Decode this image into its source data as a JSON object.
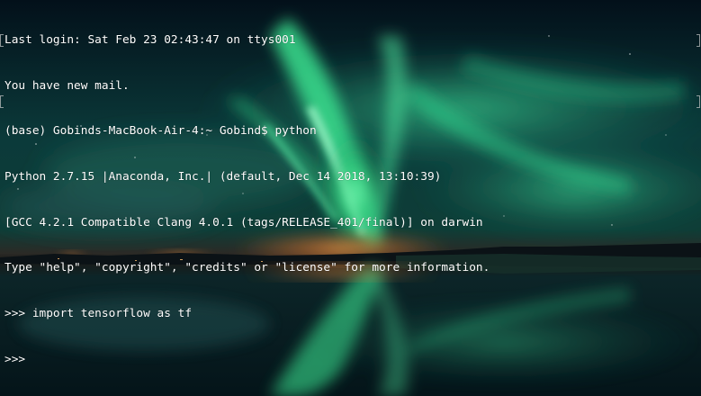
{
  "terminal": {
    "lines": [
      "Last login: Sat Feb 23 02:43:47 on ttys001",
      "You have new mail.",
      "(base) Gobinds-MacBook-Air-4:~ Gobind$ python",
      "Python 2.7.15 |Anaconda, Inc.| (default, Dec 14 2018, 13:10:39)",
      "[GCC 4.2.1 Compatible Clang 4.0.1 (tags/RELEASE_401/final)] on darwin",
      "Type \"help\", \"copyright\", \"credits\" or \"license\" for more information.",
      ">>> import tensorflow as tf",
      ">>> "
    ]
  },
  "colors": {
    "text": "#ffffff",
    "aurora_green": "#35d08a",
    "sky_dark": "#04131c",
    "horizon_glow": "#f08a3a"
  },
  "wallpaper": {
    "icon": "aurora-reflection-image"
  }
}
